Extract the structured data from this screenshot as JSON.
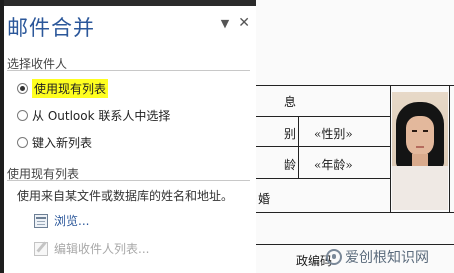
{
  "pane": {
    "title": "邮件合并",
    "controls": {
      "menu": "▼",
      "close": "✕"
    },
    "select_recipients": {
      "label": "选择收件人",
      "options": [
        {
          "label": "使用现有列表",
          "checked": true,
          "highlighted": true
        },
        {
          "label": "从 Outlook 联系人中选择",
          "checked": false,
          "highlighted": false
        },
        {
          "label": "键入新列表",
          "checked": false,
          "highlighted": false
        }
      ]
    },
    "existing_list": {
      "label": "使用现有列表",
      "description": "使用来自某文件或数据库的姓名和地址。",
      "browse": "浏览...",
      "edit_recipients": "编辑收件人列表..."
    }
  },
  "document": {
    "cells": {
      "title_fragment": "息",
      "gender_label": "别",
      "gender_field": "«性别»",
      "age_label": "龄",
      "age_field": "«年龄»",
      "fragment_a": "婚",
      "fragment_b": "政编码"
    }
  },
  "watermark": {
    "text": "爱创根知识网"
  },
  "colors": {
    "accent": "#2b579a",
    "highlight": "#ffff1f"
  },
  "icons": {
    "radio_checked": "radio-checked-icon",
    "radio_unchecked": "radio-unchecked-icon",
    "browse": "browse-file-icon",
    "edit": "edit-list-icon"
  }
}
